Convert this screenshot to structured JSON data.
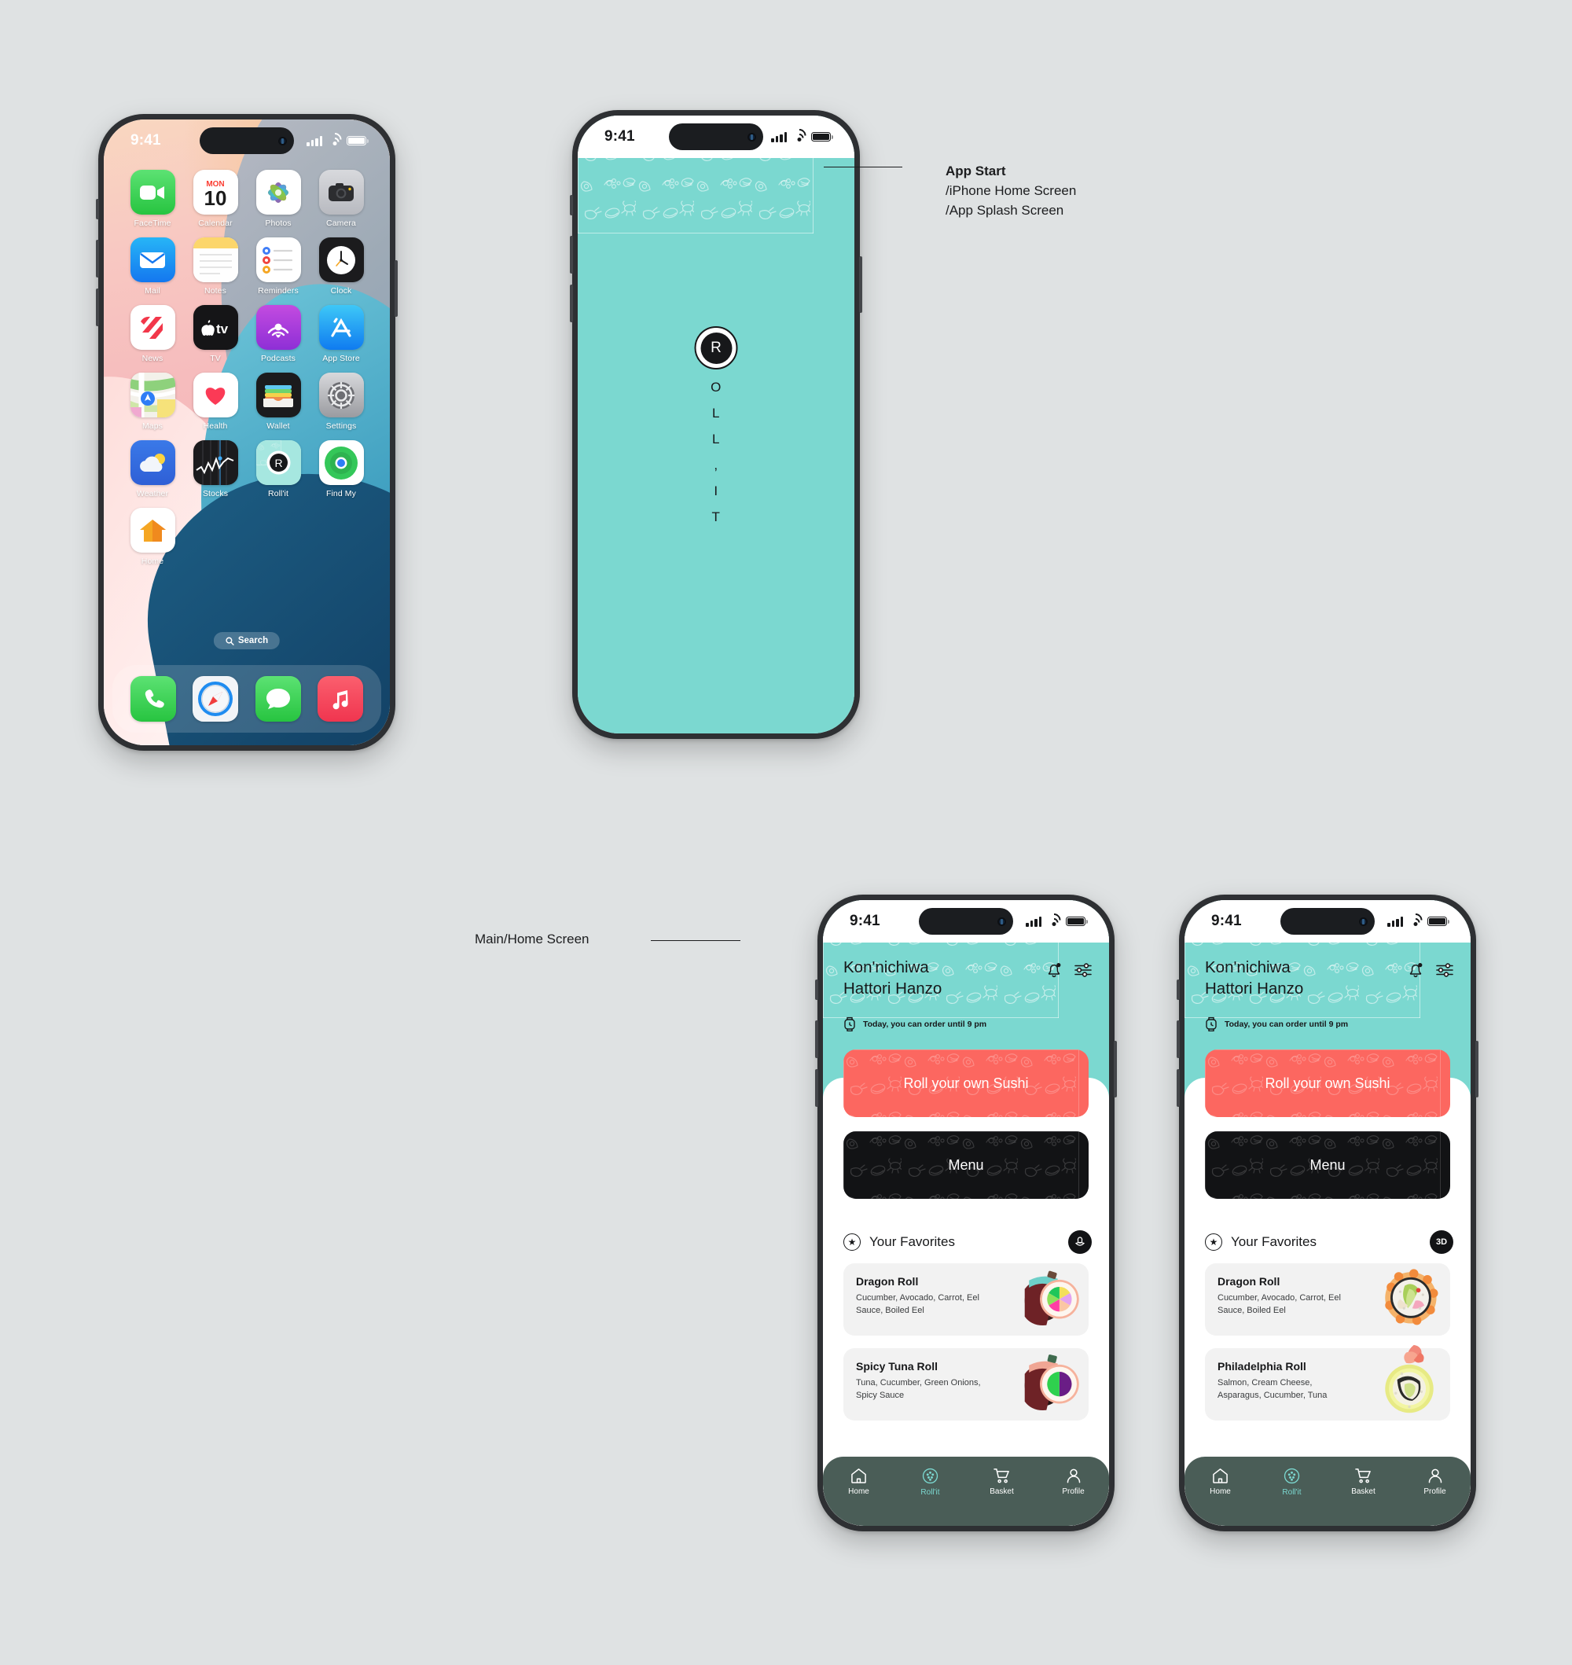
{
  "canvas": {
    "background": "#dfe2e3"
  },
  "annotations": [
    {
      "id": "app-start",
      "title": "App Start",
      "lines": [
        "/iPhone Home Screen",
        "/App Splash Screen"
      ]
    },
    {
      "id": "main-home",
      "title": "Main/Home Screen"
    }
  ],
  "brand": {
    "teal": "#7bd8d0",
    "coral": "#fc6760",
    "black": "#121315",
    "tabbar": "#4a5d57",
    "logo_letter": "R",
    "logo_vertical": [
      "O",
      "L",
      "L",
      ",",
      "I",
      "T"
    ],
    "app_name": "Roll'it"
  },
  "status_bar": {
    "time": "9:41",
    "signal": "cellular-bars",
    "wifi": "wifi-icon",
    "battery": "battery-icon"
  },
  "ios_home": {
    "apps": [
      {
        "label": "FaceTime",
        "icon": "facetime-icon"
      },
      {
        "label": "Calendar",
        "icon": "calendar-icon",
        "day_name": "MON",
        "day_number": "10"
      },
      {
        "label": "Photos",
        "icon": "photos-icon"
      },
      {
        "label": "Camera",
        "icon": "camera-icon"
      },
      {
        "label": "Mail",
        "icon": "mail-icon"
      },
      {
        "label": "Notes",
        "icon": "notes-icon"
      },
      {
        "label": "Reminders",
        "icon": "reminders-icon"
      },
      {
        "label": "Clock",
        "icon": "clock-icon"
      },
      {
        "label": "News",
        "icon": "news-icon"
      },
      {
        "label": "TV",
        "icon": "tv-icon"
      },
      {
        "label": "Podcasts",
        "icon": "podcasts-icon"
      },
      {
        "label": "App Store",
        "icon": "app-store-icon"
      },
      {
        "label": "Maps",
        "icon": "maps-icon"
      },
      {
        "label": "Health",
        "icon": "health-icon"
      },
      {
        "label": "Wallet",
        "icon": "wallet-icon"
      },
      {
        "label": "Settings",
        "icon": "settings-icon"
      },
      {
        "label": "Weather",
        "icon": "weather-icon"
      },
      {
        "label": "Stocks",
        "icon": "stocks-icon"
      },
      {
        "label": "Roll'it",
        "icon": "rollit-icon"
      },
      {
        "label": "Find My",
        "icon": "find-my-icon"
      },
      {
        "label": "Home",
        "icon": "home-app-icon"
      }
    ],
    "search_label": "Search",
    "dock": [
      {
        "label": "Phone",
        "icon": "phone-icon"
      },
      {
        "label": "Safari",
        "icon": "safari-icon"
      },
      {
        "label": "Messages",
        "icon": "messages-icon"
      },
      {
        "label": "Music",
        "icon": "music-icon"
      }
    ]
  },
  "app_home": {
    "greeting_line1": "Kon'nichiwa",
    "greeting_line2": "Hattori Hanzo",
    "notice": "Today, you can order until 9 pm",
    "header_icons": [
      {
        "name": "bell-icon"
      },
      {
        "name": "sliders-icon"
      }
    ],
    "cta_primary": "Roll your own Sushi",
    "cta_secondary": "Menu",
    "favorites_title": "Your Favorites",
    "variant_a": {
      "toggle_label": "",
      "toggle_icon": "flower-icon",
      "items": [
        {
          "title": "Dragon Roll",
          "desc": "Cucumber, Avocado, Carrot, Eel Sauce, Boiled Eel",
          "thumb": "sushi-3d-render"
        },
        {
          "title": "Spicy Tuna Roll",
          "desc": "Tuna, Cucumber, Green Onions, Spicy Sauce",
          "thumb": "sushi-3d-render"
        }
      ]
    },
    "variant_b": {
      "toggle_label": "3D",
      "toggle_icon": "3d-badge",
      "items": [
        {
          "title": "Dragon Roll",
          "desc": "Cucumber, Avocado, Carrot, Eel Sauce, Boiled Eel",
          "thumb": "sushi-photo"
        },
        {
          "title": "Philadelphia Roll",
          "desc": "Salmon, Cream Cheese, Asparagus, Cucumber, Tuna",
          "thumb": "sushi-photo"
        }
      ]
    },
    "tabs": [
      {
        "label": "Home",
        "icon": "home-icon",
        "active": false
      },
      {
        "label": "Roll'it",
        "icon": "rollit-icon",
        "active": true
      },
      {
        "label": "Basket",
        "icon": "cart-icon",
        "active": false
      },
      {
        "label": "Profile",
        "icon": "person-icon",
        "active": false
      }
    ]
  }
}
